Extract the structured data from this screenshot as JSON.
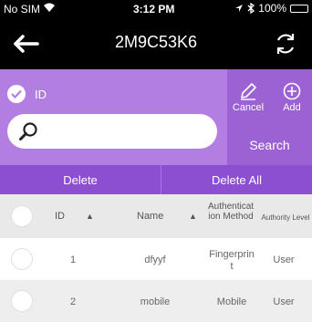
{
  "status_bar": {
    "carrier": "No SIM",
    "time": "3:12 PM",
    "battery": "100%",
    "icons": [
      "wifi-icon",
      "location-icon",
      "bluetooth-icon",
      "battery-icon"
    ]
  },
  "nav": {
    "title": "2M9C53K6",
    "back_icon": "back-arrow-icon",
    "refresh_icon": "refresh-icon"
  },
  "toolbar": {
    "id_checkbox_label": "ID",
    "search_placeholder": "",
    "cancel_label": "Cancel",
    "add_label": "Add",
    "search_label": "Search"
  },
  "delete_bar": {
    "delete_label": "Delete",
    "delete_all_label": "Delete All"
  },
  "table": {
    "headers": {
      "id": "ID",
      "name": "Name",
      "auth_method": "Authenticat ion Method",
      "authority_level": "Authority Level"
    },
    "rows": [
      {
        "id": "1",
        "name": "dfyyf",
        "auth_method": "Fingerprin t",
        "authority_level": "User"
      },
      {
        "id": "2",
        "name": "mobile",
        "auth_method": "Mobile",
        "authority_level": "User"
      }
    ]
  },
  "colors": {
    "toolbar": "#b27ee2",
    "action_panel": "#9c62d4",
    "delete_bar": "#8d4fd1",
    "nav_bg": "#000000"
  }
}
